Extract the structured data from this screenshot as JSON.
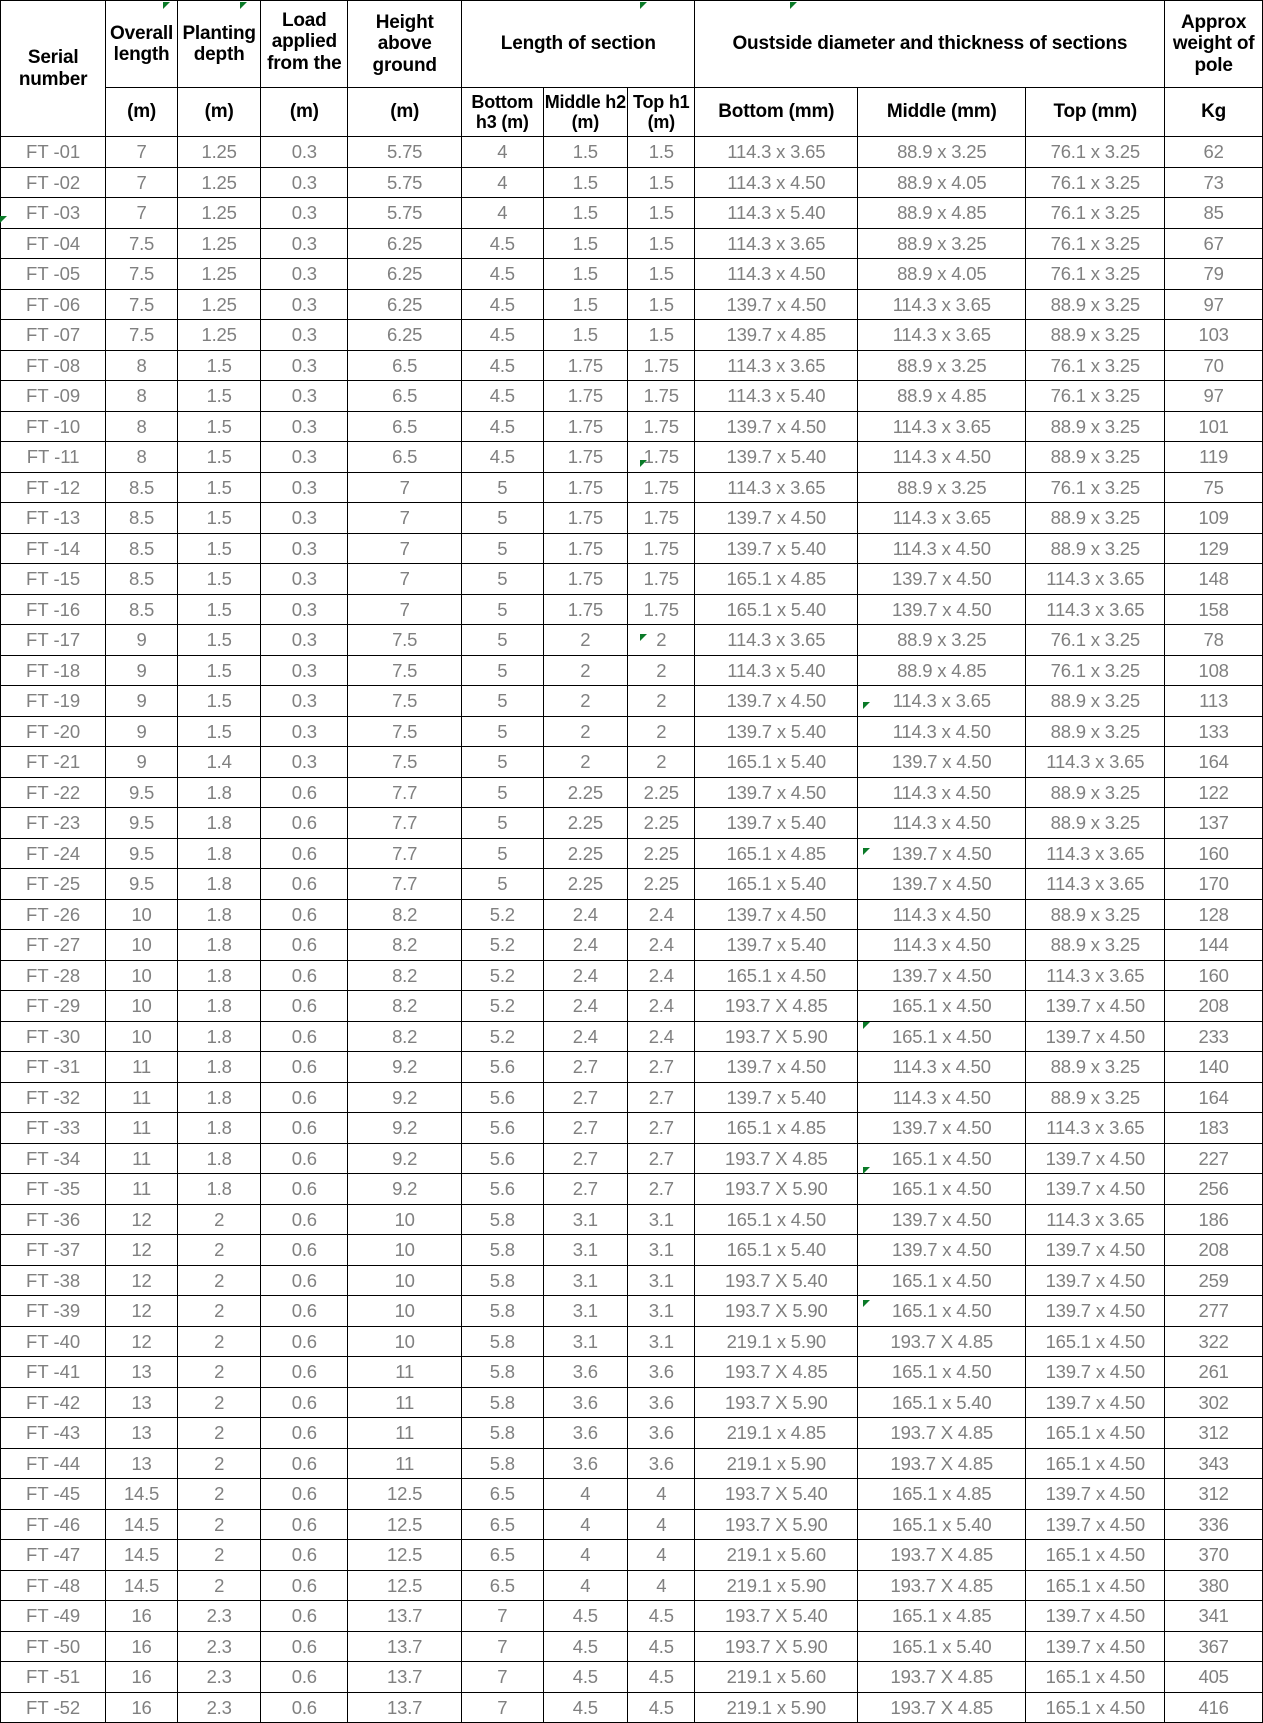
{
  "table": {
    "header": {
      "group_row": [
        {
          "label": "Serial number",
          "key": "serial"
        },
        {
          "label": "Overall length",
          "key": "overall_length"
        },
        {
          "label": "Planting depth",
          "key": "planting_depth"
        },
        {
          "label": "Load applied from the",
          "key": "load_applied"
        },
        {
          "label": "Height above ground",
          "key": "height_above_ground"
        },
        {
          "label": "Length of section",
          "key": "length_of_section"
        },
        {
          "label": "Oustside diameter and thickness of sections",
          "key": "outside_diameter"
        },
        {
          "label": "Approx weight of pole",
          "key": "approx_weight"
        }
      ],
      "unit_row": [
        {
          "label": "(m)",
          "key": "overall_length_unit"
        },
        {
          "label": "(m)",
          "key": "planting_depth_unit"
        },
        {
          "label": "(m)",
          "key": "load_applied_unit"
        },
        {
          "label": "(m)",
          "key": "height_above_ground_unit"
        },
        {
          "label": "Bottom h3 (m)",
          "key": "bottom_h3"
        },
        {
          "label": "Middle h2 (m)",
          "key": "middle_h2"
        },
        {
          "label": "Top h1 (m)",
          "key": "top_h1"
        },
        {
          "label": "Bottom (mm)",
          "key": "od_bottom"
        },
        {
          "label": "Middle (mm)",
          "key": "od_middle"
        },
        {
          "label": "Top (mm)",
          "key": "od_top"
        },
        {
          "label": "Kg",
          "key": "weight_kg"
        }
      ]
    },
    "columns": [
      "serial",
      "overall_length",
      "planting_depth",
      "load_applied",
      "height_above_ground",
      "bottom_h3",
      "middle_h2",
      "top_h1",
      "od_bottom",
      "od_middle",
      "od_top",
      "weight_kg"
    ],
    "rows": [
      [
        "FT -01",
        "7",
        "1.25",
        "0.3",
        "5.75",
        "4",
        "1.5",
        "1.5",
        "114.3 x 3.65",
        "88.9 x 3.25",
        "76.1 x 3.25",
        "62"
      ],
      [
        "FT -02",
        "7",
        "1.25",
        "0.3",
        "5.75",
        "4",
        "1.5",
        "1.5",
        "114.3 x 4.50",
        "88.9 x 4.05",
        "76.1 x 3.25",
        "73"
      ],
      [
        "FT -03",
        "7",
        "1.25",
        "0.3",
        "5.75",
        "4",
        "1.5",
        "1.5",
        "114.3 x 5.40",
        "88.9 x 4.85",
        "76.1 x 3.25",
        "85"
      ],
      [
        "FT -04",
        "7.5",
        "1.25",
        "0.3",
        "6.25",
        "4.5",
        "1.5",
        "1.5",
        "114.3 x 3.65",
        "88.9 x 3.25",
        "76.1 x 3.25",
        "67"
      ],
      [
        "FT -05",
        "7.5",
        "1.25",
        "0.3",
        "6.25",
        "4.5",
        "1.5",
        "1.5",
        "114.3 x 4.50",
        "88.9 x 4.05",
        "76.1 x 3.25",
        "79"
      ],
      [
        "FT -06",
        "7.5",
        "1.25",
        "0.3",
        "6.25",
        "4.5",
        "1.5",
        "1.5",
        "139.7 x 4.50",
        "114.3 x 3.65",
        "88.9 x 3.25",
        "97"
      ],
      [
        "FT -07",
        "7.5",
        "1.25",
        "0.3",
        "6.25",
        "4.5",
        "1.5",
        "1.5",
        "139.7 x 4.85",
        "114.3 x 3.65",
        "88.9 x 3.25",
        "103"
      ],
      [
        "FT -08",
        "8",
        "1.5",
        "0.3",
        "6.5",
        "4.5",
        "1.75",
        "1.75",
        "114.3 x 3.65",
        "88.9 x 3.25",
        "76.1 x 3.25",
        "70"
      ],
      [
        "FT -09",
        "8",
        "1.5",
        "0.3",
        "6.5",
        "4.5",
        "1.75",
        "1.75",
        "114.3 x 5.40",
        "88.9 x 4.85",
        "76.1 x 3.25",
        "97"
      ],
      [
        "FT -10",
        "8",
        "1.5",
        "0.3",
        "6.5",
        "4.5",
        "1.75",
        "1.75",
        "139.7 x 4.50",
        "114.3 x 3.65",
        "88.9 x 3.25",
        "101"
      ],
      [
        "FT -11",
        "8",
        "1.5",
        "0.3",
        "6.5",
        "4.5",
        "1.75",
        "1.75",
        "139.7 x 5.40",
        "114.3 x 4.50",
        "88.9 x 3.25",
        "119"
      ],
      [
        "FT -12",
        "8.5",
        "1.5",
        "0.3",
        "7",
        "5",
        "1.75",
        "1.75",
        "114.3 x 3.65",
        "88.9 x 3.25",
        "76.1 x 3.25",
        "75"
      ],
      [
        "FT -13",
        "8.5",
        "1.5",
        "0.3",
        "7",
        "5",
        "1.75",
        "1.75",
        "139.7 x 4.50",
        "114.3 x 3.65",
        "88.9 x 3.25",
        "109"
      ],
      [
        "FT -14",
        "8.5",
        "1.5",
        "0.3",
        "7",
        "5",
        "1.75",
        "1.75",
        "139.7 x 5.40",
        "114.3 x 4.50",
        "88.9 x 3.25",
        "129"
      ],
      [
        "FT -15",
        "8.5",
        "1.5",
        "0.3",
        "7",
        "5",
        "1.75",
        "1.75",
        "165.1 x 4.85",
        "139.7 x 4.50",
        "114.3 x 3.65",
        "148"
      ],
      [
        "FT -16",
        "8.5",
        "1.5",
        "0.3",
        "7",
        "5",
        "1.75",
        "1.75",
        "165.1 x 5.40",
        "139.7 x 4.50",
        "114.3 x 3.65",
        "158"
      ],
      [
        "FT -17",
        "9",
        "1.5",
        "0.3",
        "7.5",
        "5",
        "2",
        "2",
        "114.3 x 3.65",
        "88.9 x 3.25",
        "76.1 x 3.25",
        "78"
      ],
      [
        "FT -18",
        "9",
        "1.5",
        "0.3",
        "7.5",
        "5",
        "2",
        "2",
        "114.3 x 5.40",
        "88.9 x 4.85",
        "76.1 x 3.25",
        "108"
      ],
      [
        "FT -19",
        "9",
        "1.5",
        "0.3",
        "7.5",
        "5",
        "2",
        "2",
        "139.7 x 4.50",
        "114.3 x 3.65",
        "88.9 x 3.25",
        "113"
      ],
      [
        "FT -20",
        "9",
        "1.5",
        "0.3",
        "7.5",
        "5",
        "2",
        "2",
        "139.7 x 5.40",
        "114.3 x 4.50",
        "88.9 x 3.25",
        "133"
      ],
      [
        "FT -21",
        "9",
        "1.4",
        "0.3",
        "7.5",
        "5",
        "2",
        "2",
        "165.1 x 5.40",
        "139.7 x 4.50",
        "114.3 x 3.65",
        "164"
      ],
      [
        "FT -22",
        "9.5",
        "1.8",
        "0.6",
        "7.7",
        "5",
        "2.25",
        "2.25",
        "139.7 x 4.50",
        "114.3 x 4.50",
        "88.9 x 3.25",
        "122"
      ],
      [
        "FT -23",
        "9.5",
        "1.8",
        "0.6",
        "7.7",
        "5",
        "2.25",
        "2.25",
        "139.7 x 5.40",
        "114.3 x 4.50",
        "88.9 x 3.25",
        "137"
      ],
      [
        "FT -24",
        "9.5",
        "1.8",
        "0.6",
        "7.7",
        "5",
        "2.25",
        "2.25",
        "165.1 x 4.85",
        "139.7 x 4.50",
        "114.3 x 3.65",
        "160"
      ],
      [
        "FT -25",
        "9.5",
        "1.8",
        "0.6",
        "7.7",
        "5",
        "2.25",
        "2.25",
        "165.1 x 5.40",
        "139.7 x 4.50",
        "114.3 x 3.65",
        "170"
      ],
      [
        "FT -26",
        "10",
        "1.8",
        "0.6",
        "8.2",
        "5.2",
        "2.4",
        "2.4",
        "139.7 x 4.50",
        "114.3 x 4.50",
        "88.9 x 3.25",
        "128"
      ],
      [
        "FT -27",
        "10",
        "1.8",
        "0.6",
        "8.2",
        "5.2",
        "2.4",
        "2.4",
        "139.7 x 5.40",
        "114.3 x 4.50",
        "88.9 x 3.25",
        "144"
      ],
      [
        "FT -28",
        "10",
        "1.8",
        "0.6",
        "8.2",
        "5.2",
        "2.4",
        "2.4",
        "165.1 x 4.50",
        "139.7 x 4.50",
        "114.3 x 3.65",
        "160"
      ],
      [
        "FT -29",
        "10",
        "1.8",
        "0.6",
        "8.2",
        "5.2",
        "2.4",
        "2.4",
        "193.7  X 4.85",
        "165.1 x 4.50",
        "139.7 x 4.50",
        "208"
      ],
      [
        "FT -30",
        "10",
        "1.8",
        "0.6",
        "8.2",
        "5.2",
        "2.4",
        "2.4",
        "193.7  X 5.90",
        "165.1 x 4.50",
        "139.7 x 4.50",
        "233"
      ],
      [
        "FT -31",
        "11",
        "1.8",
        "0.6",
        "9.2",
        "5.6",
        "2.7",
        "2.7",
        "139.7 x 4.50",
        "114.3 x 4.50",
        "88.9 x 3.25",
        "140"
      ],
      [
        "FT -32",
        "11",
        "1.8",
        "0.6",
        "9.2",
        "5.6",
        "2.7",
        "2.7",
        "139.7 x 5.40",
        "114.3 x 4.50",
        "88.9 x 3.25",
        "164"
      ],
      [
        "FT -33",
        "11",
        "1.8",
        "0.6",
        "9.2",
        "5.6",
        "2.7",
        "2.7",
        "165.1 x 4.85",
        "139.7 x 4.50",
        "114.3 x 3.65",
        "183"
      ],
      [
        "FT -34",
        "11",
        "1.8",
        "0.6",
        "9.2",
        "5.6",
        "2.7",
        "2.7",
        "193.7  X 4.85",
        "165.1 x 4.50",
        "139.7 x 4.50",
        "227"
      ],
      [
        "FT -35",
        "11",
        "1.8",
        "0.6",
        "9.2",
        "5.6",
        "2.7",
        "2.7",
        "193.7  X 5.90",
        "165.1 x 4.50",
        "139.7 x 4.50",
        "256"
      ],
      [
        "FT -36",
        "12",
        "2",
        "0.6",
        "10",
        "5.8",
        "3.1",
        "3.1",
        "165.1 x 4.50",
        "139.7 x 4.50",
        "114.3 x 3.65",
        "186"
      ],
      [
        "FT -37",
        "12",
        "2",
        "0.6",
        "10",
        "5.8",
        "3.1",
        "3.1",
        "165.1 x 5.40",
        "139.7 x 4.50",
        "139.7 x 4.50",
        "208"
      ],
      [
        "FT -38",
        "12",
        "2",
        "0.6",
        "10",
        "5.8",
        "3.1",
        "3.1",
        "193.7 X 5.40",
        "165.1 x 4.50",
        "139.7 x 4.50",
        "259"
      ],
      [
        "FT -39",
        "12",
        "2",
        "0.6",
        "10",
        "5.8",
        "3.1",
        "3.1",
        "193.7  X 5.90",
        "165.1 x 4.50",
        "139.7 x 4.50",
        "277"
      ],
      [
        "FT -40",
        "12",
        "2",
        "0.6",
        "10",
        "5.8",
        "3.1",
        "3.1",
        "219.1 x 5.90",
        "193.7  X 4.85",
        "165.1 x 4.50",
        "322"
      ],
      [
        "FT -41",
        "13",
        "2",
        "0.6",
        "11",
        "5.8",
        "3.6",
        "3.6",
        "193.7  X 4.85",
        "165.1 x 4.50",
        "139.7 x 4.50",
        "261"
      ],
      [
        "FT -42",
        "13",
        "2",
        "0.6",
        "11",
        "5.8",
        "3.6",
        "3.6",
        "193.7  X 5.90",
        "165.1 x 5.40",
        "139.7 x 4.50",
        "302"
      ],
      [
        "FT -43",
        "13",
        "2",
        "0.6",
        "11",
        "5.8",
        "3.6",
        "3.6",
        "219.1 x 4.85",
        "193.7  X 4.85",
        "165.1 x 4.50",
        "312"
      ],
      [
        "FT -44",
        "13",
        "2",
        "0.6",
        "11",
        "5.8",
        "3.6",
        "3.6",
        "219.1 x 5.90",
        "193.7  X 4.85",
        "165.1 x 4.50",
        "343"
      ],
      [
        "FT -45",
        "14.5",
        "2",
        "0.6",
        "12.5",
        "6.5",
        "4",
        "4",
        "193.7 X 5.40",
        "165.1 x 4.85",
        "139.7 x 4.50",
        "312"
      ],
      [
        "FT -46",
        "14.5",
        "2",
        "0.6",
        "12.5",
        "6.5",
        "4",
        "4",
        "193.7  X 5.90",
        "165.1 x 5.40",
        "139.7 x 4.50",
        "336"
      ],
      [
        "FT -47",
        "14.5",
        "2",
        "0.6",
        "12.5",
        "6.5",
        "4",
        "4",
        "219.1 x 5.60",
        "193.7  X 4.85",
        "165.1 x 4.50",
        "370"
      ],
      [
        "FT -48",
        "14.5",
        "2",
        "0.6",
        "12.5",
        "6.5",
        "4",
        "4",
        "219.1 x 5.90",
        "193.7  X 4.85",
        "165.1 x 4.50",
        "380"
      ],
      [
        "FT -49",
        "16",
        "2.3",
        "0.6",
        "13.7",
        "7",
        "4.5",
        "4.5",
        "193.7 X 5.40",
        "165.1 x 4.85",
        "139.7 x 4.50",
        "341"
      ],
      [
        "FT -50",
        "16",
        "2.3",
        "0.6",
        "13.7",
        "7",
        "4.5",
        "4.5",
        "193.7  X 5.90",
        "165.1 x 5.40",
        "139.7 x 4.50",
        "367"
      ],
      [
        "FT -51",
        "16",
        "2.3",
        "0.6",
        "13.7",
        "7",
        "4.5",
        "4.5",
        "219.1 x 5.60",
        "193.7  X 4.85",
        "165.1 x 4.50",
        "405"
      ],
      [
        "FT -52",
        "16",
        "2.3",
        "0.6",
        "13.7",
        "7",
        "4.5",
        "4.5",
        "219.1 x 5.90",
        "193.7  X 4.85",
        "165.1 x 4.50",
        "416"
      ]
    ]
  },
  "colors": {
    "grid": "#000000",
    "header_text": "#000000",
    "data_text": "#808080",
    "background": "#ffffff",
    "comment_marker": "#0a7a28"
  }
}
